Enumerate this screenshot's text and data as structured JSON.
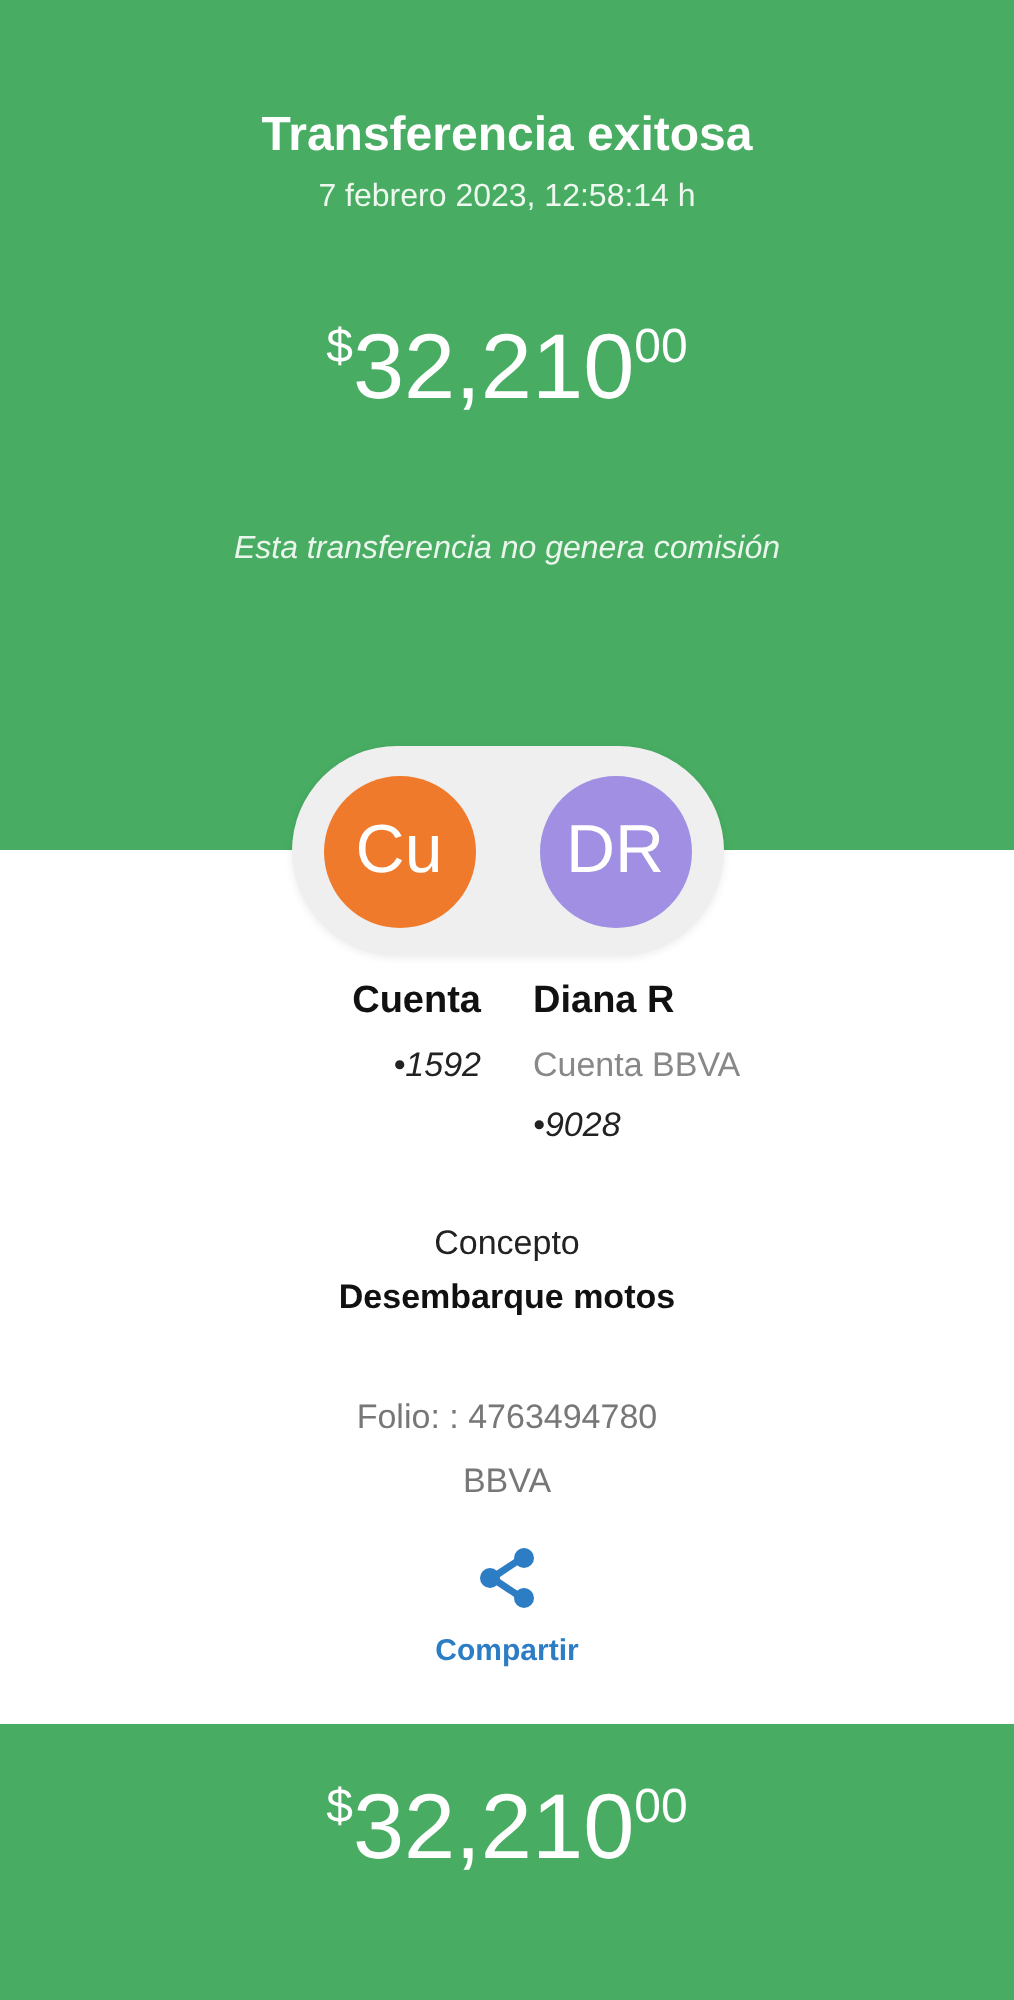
{
  "header": {
    "title": "Transferencia exitosa",
    "datetime": "7 febrero 2023, 12:58:14 h",
    "amount": {
      "currency": "$",
      "integer": "32,210",
      "cents": "00"
    },
    "note": "Esta transferencia no genera comisión"
  },
  "parties": [
    {
      "initials": "Cu",
      "color": "#f07a2c",
      "name": "Cuenta",
      "lines": [
        "•1592"
      ]
    },
    {
      "initials": "DR",
      "color": "#a08fe2",
      "name": "Diana R",
      "lines": [
        "Cuenta BBVA",
        "•9028"
      ]
    }
  ],
  "concept": {
    "label": "Concepto",
    "value": "Desembarque motos"
  },
  "folio": "Folio: : 4763494780",
  "bank": "BBVA",
  "share": {
    "label": "Compartir"
  },
  "footer": {
    "amount": {
      "currency": "$",
      "integer": "32,210",
      "cents": "00"
    }
  }
}
